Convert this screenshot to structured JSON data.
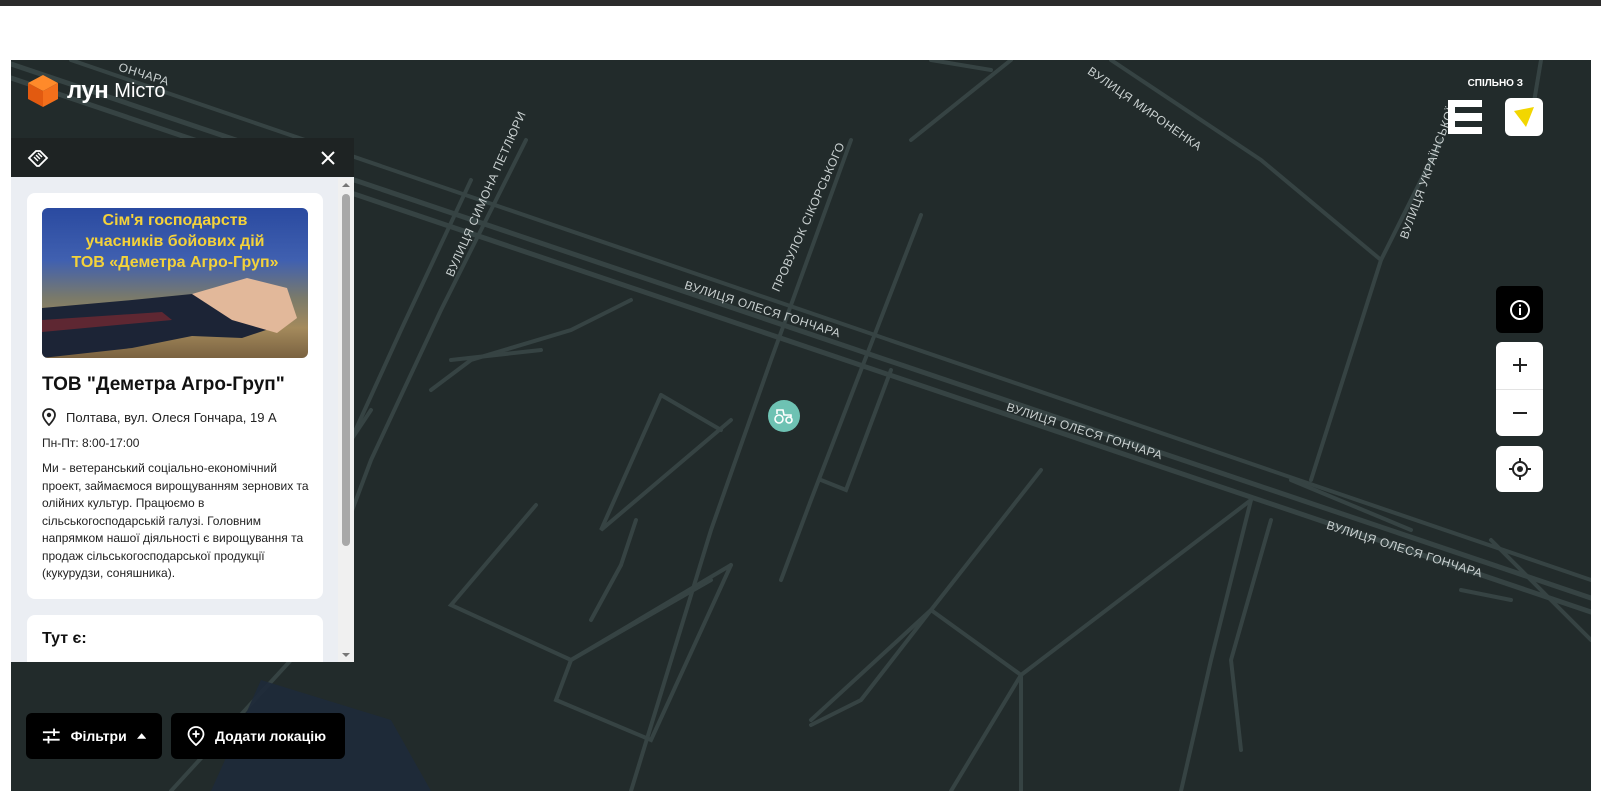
{
  "brand": {
    "name": "лун",
    "product": "Місто"
  },
  "partner": {
    "label": "СПІЛЬНО З"
  },
  "streets": [
    {
      "text": "ВУЛИЦЯ ОЛЕСЯ ГОНЧАРА"
    },
    {
      "text": "ВУЛИЦЯ ОЛЕСЯ ГОНЧАРА"
    },
    {
      "text": "ВУЛИЦЯ ОЛЕСЯ ГОНЧАРА"
    },
    {
      "text": "ВУЛИЦЯ СИМОНА ПЕТЛЮРИ"
    },
    {
      "text": "ПРОВУЛОК СІКОРСЬКОГО"
    },
    {
      "text": "ВУЛИЦЯ МИРОНЕНКА"
    },
    {
      "text": "ВУЛИЦЯ УКРАЇНСЬКОЇ"
    },
    {
      "text": "ОНЧАРА"
    }
  ],
  "place": {
    "image_text": [
      "Сім'я господарств",
      "учасників бойових дій",
      "ТОВ «Деметра Агро-Груп»"
    ],
    "title": "ТОВ \"Деметра Агро-Груп\"",
    "address": "Полтава, вул. Олеся Гончара, 19 А",
    "hours": "Пн-Пт: 8:00-17:00",
    "description": "Ми - ветеранський соціально-економічний проект, займаємося вирощуванням зернових та олійних культур. Працюємо в сільськогосподарській галузі. Головним напрямком нашої діяльності є вирощування та продаж сільськогосподарської продукції (кукурудзи, соняшника).",
    "features_title": "Тут є:"
  },
  "buttons": {
    "filters": "Фільтри",
    "add_location": "Додати локацію"
  },
  "colors": {
    "map_bg": "#222b2b",
    "road": "#364343",
    "marker": "#6ec2b3",
    "image_text": "#f4d23a"
  }
}
